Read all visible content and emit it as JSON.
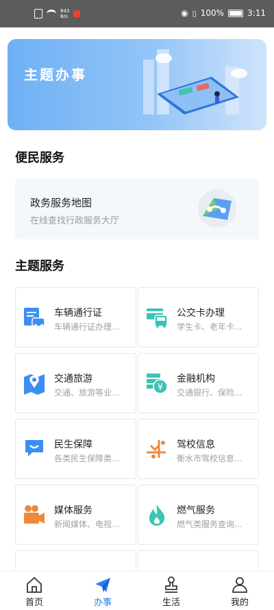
{
  "status_bar": {
    "net_speed_top": "843",
    "net_speed_bottom": "B/s",
    "battery": "100%",
    "time": "3:11"
  },
  "banner": {
    "title": "主题办事"
  },
  "convenience": {
    "title": "便民服务",
    "map_card": {
      "title": "政务服务地图",
      "subtitle": "在线查找行政服务大厅",
      "icon": "map-route-icon"
    }
  },
  "theme": {
    "title": "主题服务",
    "items": [
      {
        "title": "车辆通行证",
        "subtitle": "车辆通行证办理...",
        "icon": "vehicle-pass-icon",
        "color": "#3b8ff3"
      },
      {
        "title": "公交卡办理",
        "subtitle": "学生卡、老年卡...",
        "icon": "bus-card-icon",
        "color": "#3cc3b4"
      },
      {
        "title": "交通旅游",
        "subtitle": "交通、旅游等业...",
        "icon": "map-pin-icon",
        "color": "#3b8ff3"
      },
      {
        "title": "金融机构",
        "subtitle": "交通银行、保险...",
        "icon": "finance-yen-icon",
        "color": "#3cc3b4"
      },
      {
        "title": "民生保障",
        "subtitle": "各类民生保障类...",
        "icon": "chat-shield-icon",
        "color": "#3b8ff3"
      },
      {
        "title": "驾校信息",
        "subtitle": "衡水市驾校信息...",
        "icon": "driving-school-icon",
        "color": "#f0883a"
      },
      {
        "title": "媒体服务",
        "subtitle": "新闻媒体、电视...",
        "icon": "video-camera-icon",
        "color": "#f0883a"
      },
      {
        "title": "燃气服务",
        "subtitle": "燃气类服务查询...",
        "icon": "flame-icon",
        "color": "#3cc3b4"
      }
    ]
  },
  "nav": {
    "items": [
      {
        "label": "首页",
        "icon": "home-icon"
      },
      {
        "label": "办事",
        "icon": "paper-plane-icon",
        "active": true
      },
      {
        "label": "生活",
        "icon": "stamp-icon"
      },
      {
        "label": "我的",
        "icon": "user-icon"
      }
    ]
  },
  "colors": {
    "accent": "#2c7df0",
    "banner": "#7db6f6",
    "teal": "#3cc3b4",
    "orange": "#f0883a"
  }
}
